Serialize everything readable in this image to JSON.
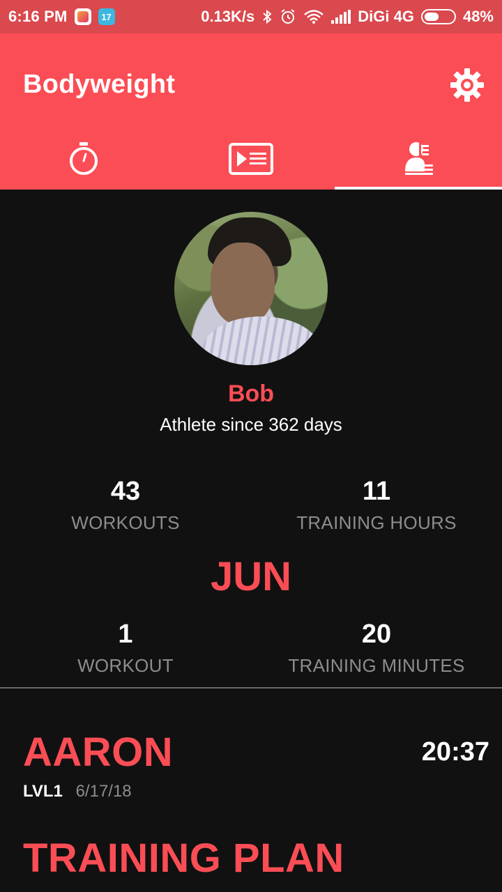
{
  "status_bar": {
    "time": "6:16 PM",
    "notif_badge": "17",
    "net_speed": "0.13K/s",
    "carrier": "DiGi 4G",
    "battery": "48%"
  },
  "app": {
    "title": "Bodyweight",
    "accent_color": "#fb4d55"
  },
  "tabs": [
    {
      "icon": "stopwatch-icon",
      "selected": false
    },
    {
      "icon": "workout-list-icon",
      "selected": false
    },
    {
      "icon": "profile-icon",
      "selected": true
    }
  ],
  "profile": {
    "name": "Bob",
    "since": "Athlete since 362 days"
  },
  "totals": {
    "workouts_value": "43",
    "workouts_label": "WORKOUTS",
    "hours_value": "11",
    "hours_label": "TRAINING HOURS"
  },
  "month": {
    "name": "JUN",
    "workout_value": "1",
    "workout_label": "WORKOUT",
    "minutes_value": "20",
    "minutes_label": "TRAINING MINUTES"
  },
  "last_workout": {
    "name": "AARON",
    "duration": "20:37",
    "level": "LVL1",
    "date": "6/17/18"
  },
  "training_plan": {
    "heading": "TRAINING PLAN"
  }
}
